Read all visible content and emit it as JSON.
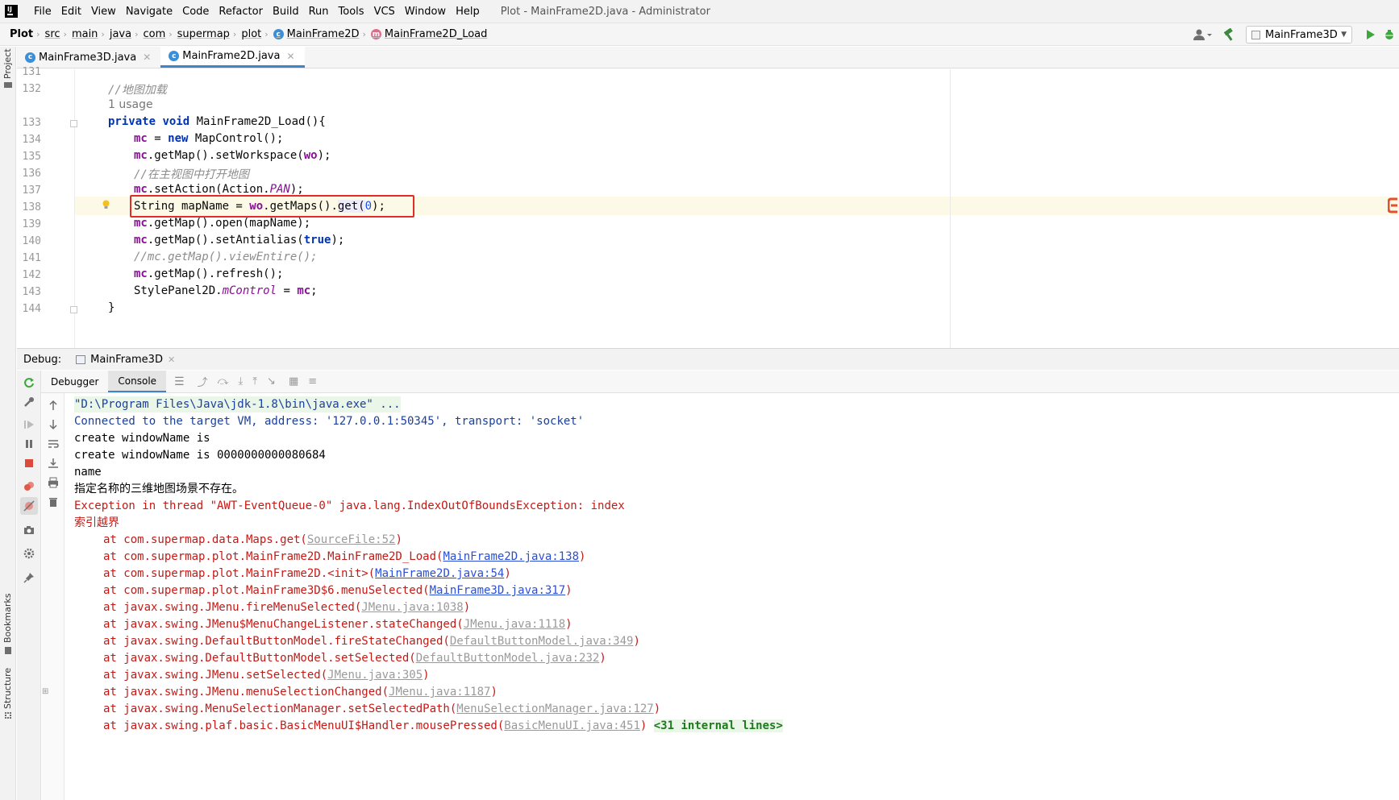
{
  "menubar": {
    "items": [
      "File",
      "Edit",
      "View",
      "Navigate",
      "Code",
      "Refactor",
      "Build",
      "Run",
      "Tools",
      "VCS",
      "Window",
      "Help"
    ],
    "window_title": "Plot - MainFrame2D.java - Administrator"
  },
  "breadcrumb": [
    "Plot",
    "src",
    "main",
    "java",
    "com",
    "supermap",
    "plot",
    "MainFrame2D",
    "MainFrame2D_Load"
  ],
  "run_config": "MainFrame3D",
  "left_strip": {
    "project": "Project",
    "bookmarks": "Bookmarks",
    "structure": "Structure"
  },
  "editor_tabs": [
    {
      "label": "MainFrame3D.java",
      "active": false
    },
    {
      "label": "MainFrame2D.java",
      "active": true
    }
  ],
  "editor": {
    "line_numbers": [
      "131",
      "132",
      "",
      "133",
      "134",
      "135",
      "136",
      "137",
      "138",
      "139",
      "140",
      "141",
      "142",
      "143",
      "144"
    ],
    "usage_hint": "1 usage",
    "lines": {
      "l132": "//地图加载",
      "l133_kw1": "private",
      "l133_kw2": "void",
      "l133_rest": " MainFrame2D_Load(){",
      "l134_f": "mc",
      "l134_mid": " = ",
      "l134_kw": "new",
      "l134_rest": " MapControl();",
      "l135_f": "mc",
      "l135_a": ".getMap().setWorkspace(",
      "l135_f2": "wo",
      "l135_b": ");",
      "l136": "//在主视图中打开地图",
      "l137_f": "mc",
      "l137_a": ".setAction(Action.",
      "l137_s": "PAN",
      "l137_b": ");",
      "l138_a": "String mapName = ",
      "l138_f": "wo",
      "l138_b": ".getMaps().",
      "l138_c": "get(",
      "l138_n": "0",
      "l138_d": ");",
      "l139_f": "mc",
      "l139_a": ".getMap().open(mapName);",
      "l140_f": "mc",
      "l140_a": ".getMap().setAntialias(",
      "l140_kw": "true",
      "l140_b": ");",
      "l141": "//mc.getMap().viewEntire();",
      "l142_f": "mc",
      "l142_a": ".getMap().refresh();",
      "l143_a": "StylePanel2D.",
      "l143_s": "mControl",
      "l143_b": " = ",
      "l143_f": "mc",
      "l143_c": ";",
      "l144": "}"
    }
  },
  "debug": {
    "label": "Debug:",
    "session": "MainFrame3D",
    "tabs": [
      "Debugger",
      "Console"
    ]
  },
  "console": {
    "cmd": "\"D:\\Program Files\\Java\\jdk-1.8\\bin\\java.exe\" ...",
    "connected": "Connected to the target VM, address: '127.0.0.1:50345', transport: 'socket'",
    "out1": "create windowName is",
    "out2": "create windowName is 0000000000080684",
    "out3": "name",
    "out4": "指定名称的三维地图场景不存在。",
    "exc": "Exception in thread \"AWT-EventQueue-0\" java.lang.IndexOutOfBoundsException: index",
    "exc2": "索引越界",
    "trace": [
      {
        "pre": "at com.supermap.data.Maps.get(",
        "link": "SourceFile:52",
        "post": ")",
        "blue": false
      },
      {
        "pre": "at com.supermap.plot.MainFrame2D.MainFrame2D_Load(",
        "link": "MainFrame2D.java:138",
        "post": ")",
        "blue": true
      },
      {
        "pre": "at com.supermap.plot.MainFrame2D.<init>(",
        "link": "MainFrame2D.java:54",
        "post": ")",
        "blue": true
      },
      {
        "pre": "at com.supermap.plot.MainFrame3D$6.menuSelected(",
        "link": "MainFrame3D.java:317",
        "post": ")",
        "blue": true
      },
      {
        "pre": "at javax.swing.JMenu.fireMenuSelected(",
        "link": "JMenu.java:1038",
        "post": ")",
        "blue": false
      },
      {
        "pre": "at javax.swing.JMenu$MenuChangeListener.stateChanged(",
        "link": "JMenu.java:1118",
        "post": ")",
        "blue": false
      },
      {
        "pre": "at javax.swing.DefaultButtonModel.fireStateChanged(",
        "link": "DefaultButtonModel.java:349",
        "post": ")",
        "blue": false
      },
      {
        "pre": "at javax.swing.DefaultButtonModel.setSelected(",
        "link": "DefaultButtonModel.java:232",
        "post": ")",
        "blue": false
      },
      {
        "pre": "at javax.swing.JMenu.setSelected(",
        "link": "JMenu.java:305",
        "post": ")",
        "blue": false
      },
      {
        "pre": "at javax.swing.JMenu.menuSelectionChanged(",
        "link": "JMenu.java:1187",
        "post": ")",
        "blue": false
      },
      {
        "pre": "at javax.swing.MenuSelectionManager.setSelectedPath(",
        "link": "MenuSelectionManager.java:127",
        "post": ")",
        "blue": false
      },
      {
        "pre": "at javax.swing.plaf.basic.BasicMenuUI$Handler.mousePressed(",
        "link": "BasicMenuUI.java:451",
        "post": ")",
        "blue": false
      }
    ],
    "internal_lines": "<31 internal lines>"
  }
}
